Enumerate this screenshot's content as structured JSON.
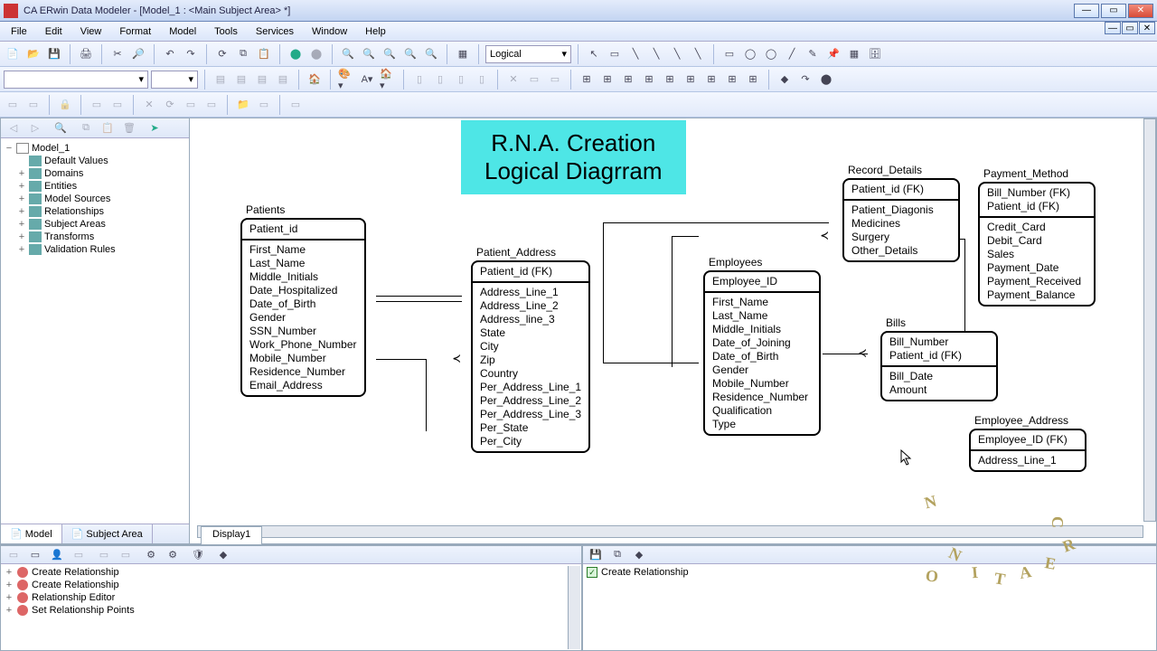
{
  "app_title": "CA ERwin Data Modeler - [Model_1 : <Main Subject Area> *]",
  "menus": [
    "File",
    "Edit",
    "View",
    "Format",
    "Model",
    "Tools",
    "Services",
    "Window",
    "Help"
  ],
  "view_combo": "Logical",
  "tree_root": "Model_1",
  "tree_items": [
    "Default Values",
    "Domains",
    "Entities",
    "Model Sources",
    "Relationships",
    "Subject Areas",
    "Transforms",
    "Validation Rules"
  ],
  "sidebar_tabs": {
    "model": "Model",
    "subject": "Subject Area"
  },
  "canvas_tab": "Display1",
  "diagram_title_l1": "R.N.A. Creation",
  "diagram_title_l2": "Logical Diagrram",
  "entities": {
    "patients": {
      "name": "Patients",
      "pk": [
        "Patient_id"
      ],
      "attrs": [
        "First_Name",
        "Last_Name",
        "Middle_Initials",
        "Date_Hospitalized",
        "Date_of_Birth",
        "Gender",
        "SSN_Number",
        "Work_Phone_Number",
        "Mobile_Number",
        "Residence_Number",
        "Email_Address"
      ]
    },
    "patient_address": {
      "name": "Patient_Address",
      "pk": [
        "Patient_id (FK)"
      ],
      "attrs": [
        "Address_Line_1",
        "Address_Line_2",
        "Address_line_3",
        "State",
        "City",
        "Zip",
        "Country",
        "Per_Address_Line_1",
        "Per_Address_Line_2",
        "Per_Address_Line_3",
        "Per_State",
        "Per_City"
      ]
    },
    "employees": {
      "name": "Employees",
      "pk": [
        "Employee_ID"
      ],
      "attrs": [
        "First_Name",
        "Last_Name",
        "Middle_Initials",
        "Date_of_Joining",
        "Date_of_Birth",
        "Gender",
        "Mobile_Number",
        "Residence_Number",
        "Qualification",
        "Type"
      ]
    },
    "record_details": {
      "name": "Record_Details",
      "pk": [
        "Patient_id (FK)"
      ],
      "attrs": [
        "Patient_Diagonis",
        "Medicines",
        "Surgery",
        "Other_Details"
      ]
    },
    "bills": {
      "name": "Bills",
      "pk": [
        "Bill_Number",
        "Patient_id (FK)"
      ],
      "attrs": [
        "Bill_Date",
        "Amount"
      ]
    },
    "payment_method": {
      "name": "Payment_Method",
      "pk": [
        "Bill_Number (FK)",
        "Patient_id (FK)"
      ],
      "attrs": [
        "Credit_Card",
        "Debit_Card",
        "Sales",
        "Payment_Date",
        "Payment_Received",
        "Payment_Balance"
      ]
    },
    "employee_address": {
      "name": "Employee_Address",
      "pk": [
        "Employee_ID (FK)"
      ],
      "attrs": [
        "Address_Line_1"
      ]
    }
  },
  "action_log": [
    "Create Relationship",
    "Create Relationship",
    "Relationship Editor",
    "Set Relationship Points"
  ],
  "result_item": "Create Relationship"
}
